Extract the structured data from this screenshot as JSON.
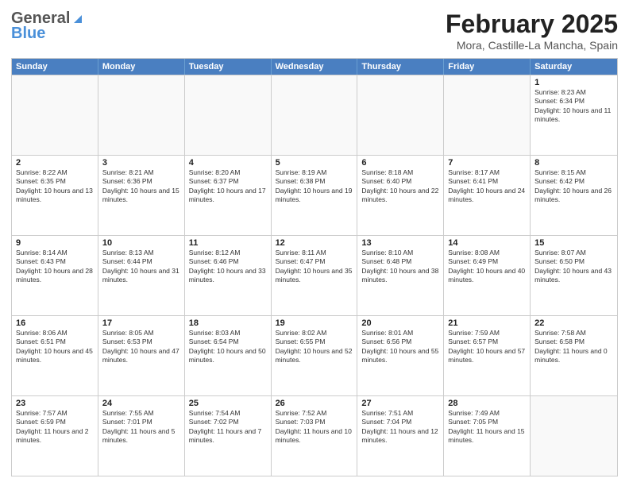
{
  "header": {
    "logo_line1": "General",
    "logo_line2": "Blue",
    "month_year": "February 2025",
    "location": "Mora, Castille-La Mancha, Spain"
  },
  "weekdays": [
    "Sunday",
    "Monday",
    "Tuesday",
    "Wednesday",
    "Thursday",
    "Friday",
    "Saturday"
  ],
  "weeks": [
    [
      {
        "day": "",
        "empty": true
      },
      {
        "day": "",
        "empty": true
      },
      {
        "day": "",
        "empty": true
      },
      {
        "day": "",
        "empty": true
      },
      {
        "day": "",
        "empty": true
      },
      {
        "day": "",
        "empty": true
      },
      {
        "day": "1",
        "sunrise": "8:23 AM",
        "sunset": "6:34 PM",
        "daylight": "10 hours and 11 minutes."
      }
    ],
    [
      {
        "day": "2",
        "sunrise": "8:22 AM",
        "sunset": "6:35 PM",
        "daylight": "10 hours and 13 minutes."
      },
      {
        "day": "3",
        "sunrise": "8:21 AM",
        "sunset": "6:36 PM",
        "daylight": "10 hours and 15 minutes."
      },
      {
        "day": "4",
        "sunrise": "8:20 AM",
        "sunset": "6:37 PM",
        "daylight": "10 hours and 17 minutes."
      },
      {
        "day": "5",
        "sunrise": "8:19 AM",
        "sunset": "6:38 PM",
        "daylight": "10 hours and 19 minutes."
      },
      {
        "day": "6",
        "sunrise": "8:18 AM",
        "sunset": "6:40 PM",
        "daylight": "10 hours and 22 minutes."
      },
      {
        "day": "7",
        "sunrise": "8:17 AM",
        "sunset": "6:41 PM",
        "daylight": "10 hours and 24 minutes."
      },
      {
        "day": "8",
        "sunrise": "8:15 AM",
        "sunset": "6:42 PM",
        "daylight": "10 hours and 26 minutes."
      }
    ],
    [
      {
        "day": "9",
        "sunrise": "8:14 AM",
        "sunset": "6:43 PM",
        "daylight": "10 hours and 28 minutes."
      },
      {
        "day": "10",
        "sunrise": "8:13 AM",
        "sunset": "6:44 PM",
        "daylight": "10 hours and 31 minutes."
      },
      {
        "day": "11",
        "sunrise": "8:12 AM",
        "sunset": "6:46 PM",
        "daylight": "10 hours and 33 minutes."
      },
      {
        "day": "12",
        "sunrise": "8:11 AM",
        "sunset": "6:47 PM",
        "daylight": "10 hours and 35 minutes."
      },
      {
        "day": "13",
        "sunrise": "8:10 AM",
        "sunset": "6:48 PM",
        "daylight": "10 hours and 38 minutes."
      },
      {
        "day": "14",
        "sunrise": "8:08 AM",
        "sunset": "6:49 PM",
        "daylight": "10 hours and 40 minutes."
      },
      {
        "day": "15",
        "sunrise": "8:07 AM",
        "sunset": "6:50 PM",
        "daylight": "10 hours and 43 minutes."
      }
    ],
    [
      {
        "day": "16",
        "sunrise": "8:06 AM",
        "sunset": "6:51 PM",
        "daylight": "10 hours and 45 minutes."
      },
      {
        "day": "17",
        "sunrise": "8:05 AM",
        "sunset": "6:53 PM",
        "daylight": "10 hours and 47 minutes."
      },
      {
        "day": "18",
        "sunrise": "8:03 AM",
        "sunset": "6:54 PM",
        "daylight": "10 hours and 50 minutes."
      },
      {
        "day": "19",
        "sunrise": "8:02 AM",
        "sunset": "6:55 PM",
        "daylight": "10 hours and 52 minutes."
      },
      {
        "day": "20",
        "sunrise": "8:01 AM",
        "sunset": "6:56 PM",
        "daylight": "10 hours and 55 minutes."
      },
      {
        "day": "21",
        "sunrise": "7:59 AM",
        "sunset": "6:57 PM",
        "daylight": "10 hours and 57 minutes."
      },
      {
        "day": "22",
        "sunrise": "7:58 AM",
        "sunset": "6:58 PM",
        "daylight": "11 hours and 0 minutes."
      }
    ],
    [
      {
        "day": "23",
        "sunrise": "7:57 AM",
        "sunset": "6:59 PM",
        "daylight": "11 hours and 2 minutes."
      },
      {
        "day": "24",
        "sunrise": "7:55 AM",
        "sunset": "7:01 PM",
        "daylight": "11 hours and 5 minutes."
      },
      {
        "day": "25",
        "sunrise": "7:54 AM",
        "sunset": "7:02 PM",
        "daylight": "11 hours and 7 minutes."
      },
      {
        "day": "26",
        "sunrise": "7:52 AM",
        "sunset": "7:03 PM",
        "daylight": "11 hours and 10 minutes."
      },
      {
        "day": "27",
        "sunrise": "7:51 AM",
        "sunset": "7:04 PM",
        "daylight": "11 hours and 12 minutes."
      },
      {
        "day": "28",
        "sunrise": "7:49 AM",
        "sunset": "7:05 PM",
        "daylight": "11 hours and 15 minutes."
      },
      {
        "day": "",
        "empty": true
      }
    ]
  ]
}
